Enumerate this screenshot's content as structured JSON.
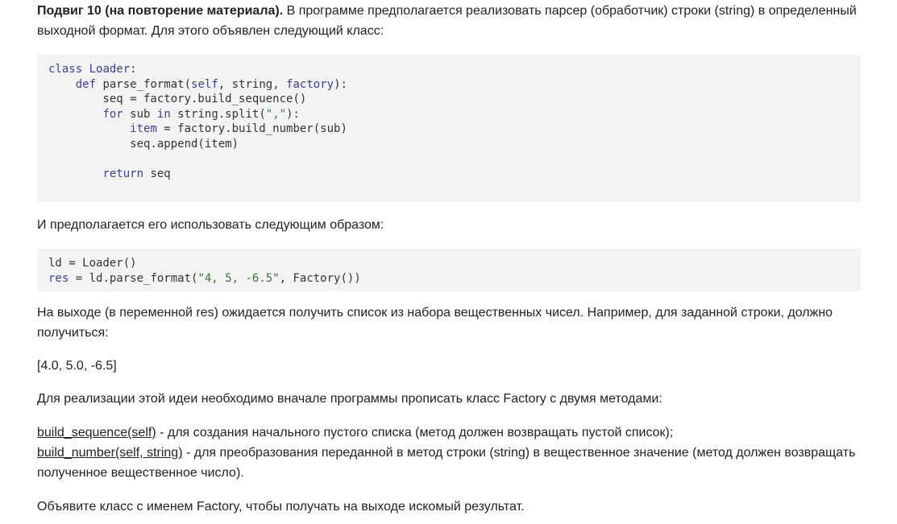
{
  "intro": {
    "title": "Подвиг 10 (на повторение материала).",
    "text": " В программе предполагается реализовать парсер (обработчик) строки (string) в определенный выходной формат. Для этого объявлен следующий класс:"
  },
  "code1": {
    "lines": [
      "class Loader:",
      "    def parse_format(self, string, factory):",
      "        seq = factory.build_sequence()",
      "        for sub in string.split(\",\"):",
      "            item = factory.build_number(sub)",
      "            seq.append(item)",
      "",
      "        return seq"
    ]
  },
  "usage_text": "И предполагается его использовать следующим образом:",
  "code2": {
    "lines": [
      "ld = Loader()",
      "res = ld.parse_format(\"4, 5, -6.5\", Factory())"
    ]
  },
  "output_text": "На выходе (в переменной res) ожидается получить список из набора вещественных чисел. Например, для заданной строки, должно получиться:",
  "example_result": "[4.0, 5.0, -6.5]",
  "factory_text": "Для реализации этой идеи необходимо вначале программы прописать класс Factory с двумя методами:",
  "methods": [
    {
      "name": "build_sequence",
      "args": "(self)",
      "description": " - для создания начального пустого списка (метод должен возвращать пустой список);"
    },
    {
      "name": "build_number",
      "args": "(self, string)",
      "description": " - для преобразования переданной в метод строки (string) в вещественное значение (метод должен возвращать полученное вещественное число)."
    }
  ],
  "final_text": "Объявите класс с именем Factory, чтобы получать на выходе искомый результат."
}
